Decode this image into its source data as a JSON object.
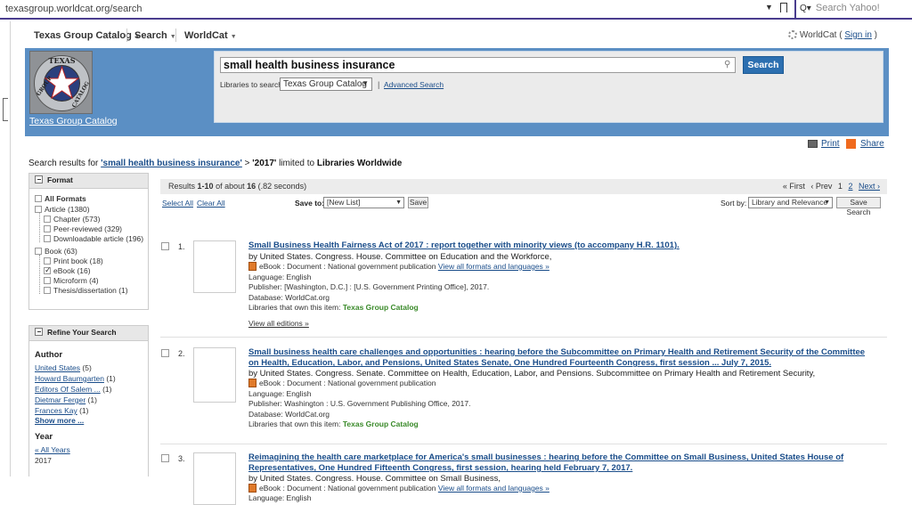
{
  "browser": {
    "url": "texasgroup.worldcat.org/search",
    "search_placeholder": "Search Yahoo!",
    "search_icon_glyph": "Q▾"
  },
  "topnav": {
    "items": [
      "Texas Group Catalog",
      "Search",
      "WorldCat"
    ],
    "worldcat_label": "WorldCat",
    "sign_in": "Sign in"
  },
  "header": {
    "logo_name": "Texas Group Catalog",
    "logo_ring_text": "TEXAS GROUP CATALOG",
    "query": "small health business insurance",
    "search_button": "Search",
    "libraries_label": "Libraries to search",
    "libraries_selected": "Texas Group Catalog",
    "advanced_search": "Advanced Search"
  },
  "actions": {
    "print": "Print",
    "share": "Share"
  },
  "results_line": {
    "prefix": "Search results for",
    "query": "'small health business insurance'",
    "sep": ">",
    "year": "'2017'",
    "limited": "limited to",
    "scope": "Libraries Worldwide"
  },
  "format_facet": {
    "header": "Format",
    "all_formats": "All Formats",
    "items": [
      {
        "label": "Article (1380)"
      },
      {
        "label": "Chapter (573)"
      },
      {
        "label": "Peer-reviewed (329)"
      },
      {
        "label": "Downloadable article (196)"
      },
      {
        "label": "Book (63)"
      },
      {
        "label": "Print book (18)"
      },
      {
        "label": "eBook (16)",
        "checked": true
      },
      {
        "label": "Microform (4)"
      },
      {
        "label": "Thesis/dissertation (1)"
      }
    ]
  },
  "refine": {
    "header": "Refine Your Search",
    "author_title": "Author",
    "authors": [
      {
        "name": "United States",
        "count": "(5)"
      },
      {
        "name": "Howard Baumgarten",
        "count": "(1)"
      },
      {
        "name": "Editors Of Salem ...",
        "count": "(1)"
      },
      {
        "name": "Dietmar Ferger",
        "count": "(1)"
      },
      {
        "name": "Frances Kay",
        "count": "(1)"
      }
    ],
    "show_more": "Show more ...",
    "year_title": "Year",
    "all_years": "« All Years",
    "year_value": "2017"
  },
  "results_bar": {
    "text_a": "Results",
    "range": "1-10",
    "text_b": "of about",
    "total": "16",
    "time": "(.82 seconds)",
    "first": "« First",
    "prev": "‹ Prev",
    "page1": "1",
    "page2": "2",
    "next": "Next ›"
  },
  "tools": {
    "select_all": "Select All",
    "clear_all": "Clear All",
    "save_to_label": "Save to:",
    "save_to_value": "[New List]",
    "save_button": "Save",
    "sort_label": "Sort by:",
    "sort_value": "Library and Relevance",
    "save_search": "Save Search"
  },
  "records": [
    {
      "num": "1.",
      "title": "Small Business Health Fairness Act of 2017 : report together with minority views (to accompany H.R. 1101).",
      "author": "by United States. Congress. House. Committee on Education and the Workforce,",
      "type": "eBook : Document : National government publication",
      "view_all": "View all formats and languages »",
      "language": "Language: English",
      "publisher": "Publisher: [Washington, D.C.] : [U.S. Government Printing Office], 2017.",
      "database": "Database: WorldCat.org",
      "libs_label": "Libraries that own this item:",
      "libs": "Texas Group Catalog",
      "editions": "View all editions »"
    },
    {
      "num": "2.",
      "title": "Small business health care challenges and opportunities : hearing before the Subcommittee on Primary Health and Retirement Security of the Committee on Health, Education, Labor, and Pensions, United States Senate, One Hundred Fourteenth Congress, first session ... July 7, 2015.",
      "author": "by United States. Congress. Senate. Committee on Health, Education, Labor, and Pensions. Subcommittee on Primary Health and Retirement Security,",
      "type": "eBook : Document : National government publication",
      "language": "Language: English",
      "publisher": "Publisher: Washington : U.S. Government Publishing Office, 2017.",
      "database": "Database: WorldCat.org",
      "libs_label": "Libraries that own this item:",
      "libs": "Texas Group Catalog"
    },
    {
      "num": "3.",
      "title": "Reimagining the health care marketplace for America's small businesses : hearing before the Committee on Small Business, United States House of Representatives, One Hundred Fifteenth Congress, first session, hearing held February 7, 2017.",
      "author": "by United States. Congress. House. Committee on Small Business,",
      "type": "eBook : Document : National government publication",
      "view_all": "View all formats and languages »",
      "language": "Language: English"
    }
  ],
  "colors": {
    "header_blue": "#5b8fc4",
    "button_blue": "#2c6fb0",
    "link_blue": "#1a4d8a",
    "green": "#3a8a2a"
  }
}
